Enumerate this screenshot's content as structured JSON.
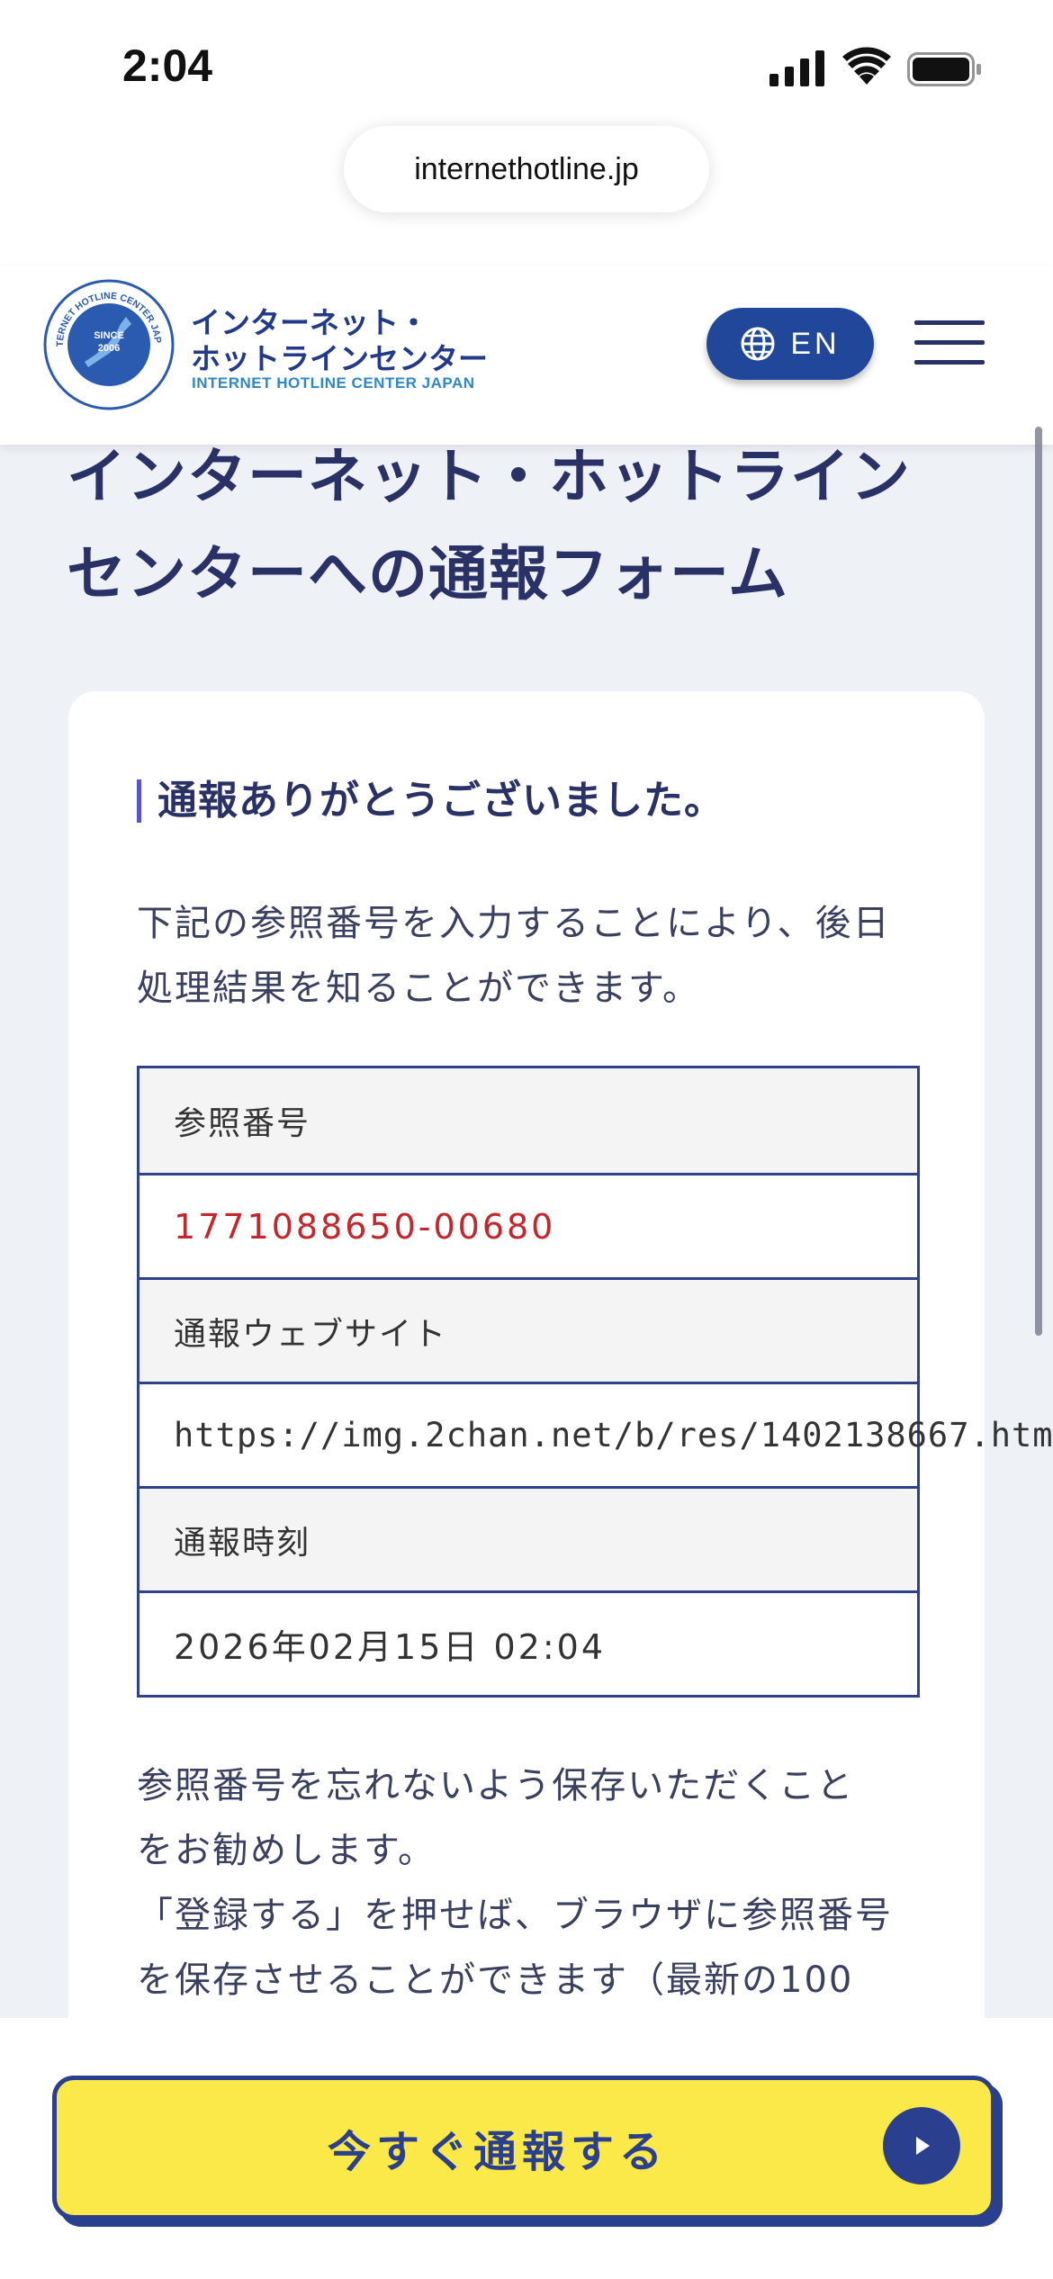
{
  "status_bar": {
    "time": "2:04"
  },
  "browser": {
    "url": "internethotline.jp"
  },
  "header": {
    "logo_seal_text": "INTERNET HOTLINE CENTER JAPAN SINCE 2006",
    "logo_title_line1": "インターネット・",
    "logo_title_line2": "ホットラインセンター",
    "logo_subtitle": "INTERNET HOTLINE CENTER JAPAN",
    "lang_label": "EN"
  },
  "page": {
    "title_line1": "インターネット・ホットライン",
    "title_line2": "センターへの通報フォーム"
  },
  "card": {
    "heading": "通報ありがとうございました。",
    "intro_line1": "下記の参照番号を入力することにより、後日",
    "intro_line2": "処理結果を知ることができます。",
    "table": [
      {
        "label": "参照番号",
        "value": "1771088650-00680"
      },
      {
        "label": "通報ウェブサイト",
        "value": "https://img.2chan.net/b/res/1402138667.htm"
      },
      {
        "label": "通報時刻",
        "value": "2026年02月15日 02:04"
      }
    ],
    "note_line1": "参照番号を忘れないよう保存いただくこと",
    "note_line2": "をお勧めします。",
    "note_line3": "「登録する」を押せば、ブラウザに参照番号",
    "note_line4": "を保存させることができます（最新の100"
  },
  "cta": {
    "label": "今すぐ通報する"
  },
  "colors": {
    "navy": "#2a3f8d",
    "button_yellow": "#fbe94a",
    "reference_red": "#c5262c",
    "page_bg": "#eef1f6"
  }
}
